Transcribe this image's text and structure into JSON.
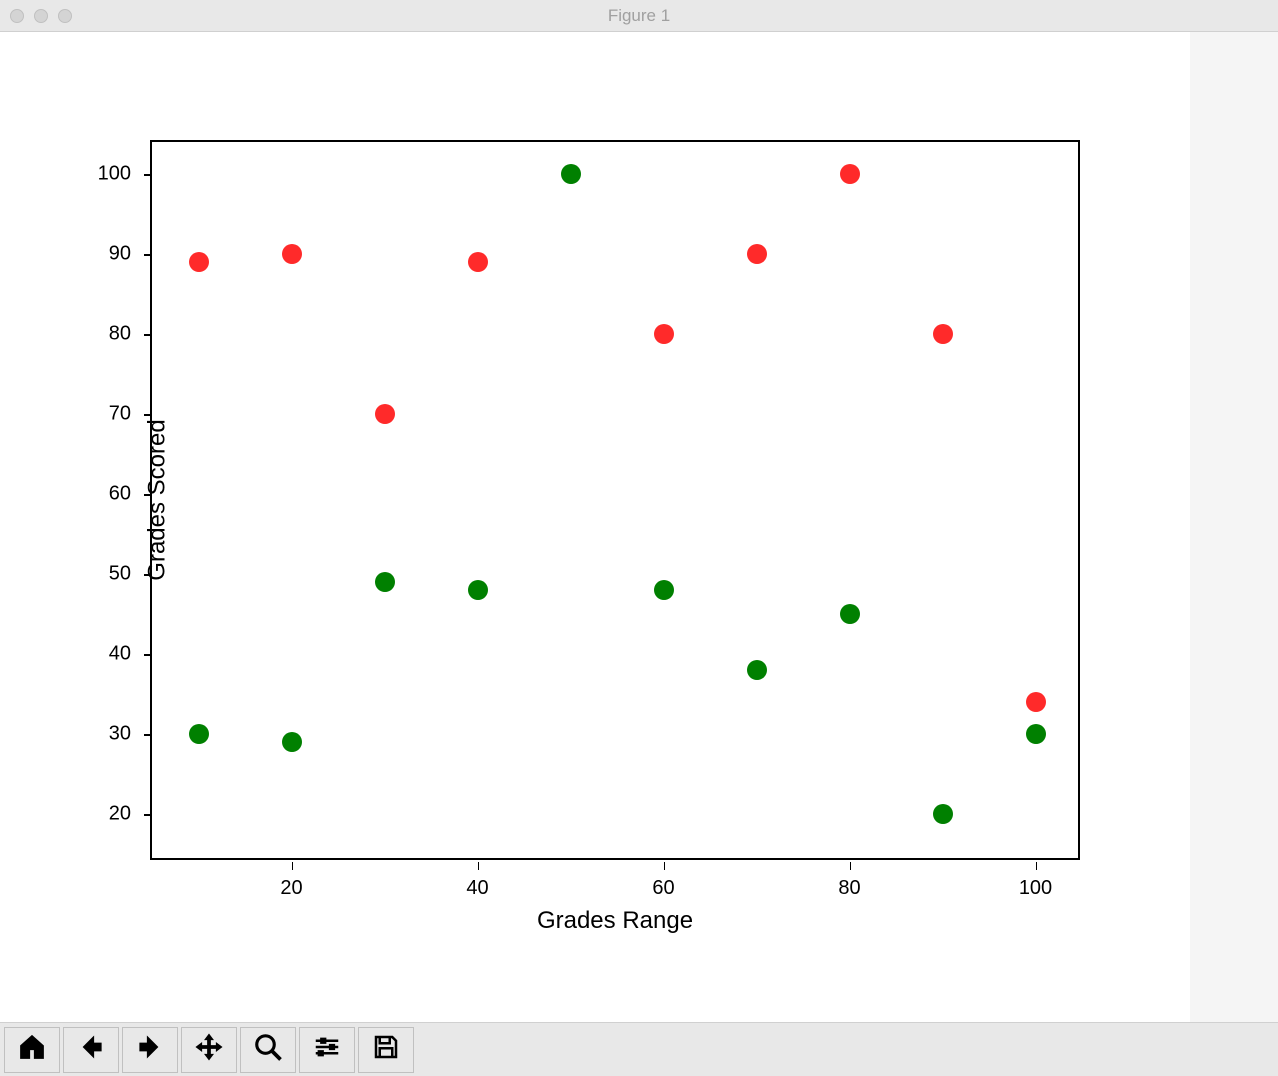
{
  "window": {
    "title": "Figure 1"
  },
  "toolbar": {
    "home": "Home",
    "back": "Back",
    "forward": "Forward",
    "pan": "Pan",
    "zoom": "Zoom",
    "configure": "Configure subplots",
    "save": "Save"
  },
  "chart_data": {
    "type": "scatter",
    "xlabel": "Grades Range",
    "ylabel": "Grades Scored",
    "xlim": [
      5,
      105
    ],
    "ylim": [
      14,
      104
    ],
    "xticks": [
      20,
      40,
      60,
      80,
      100
    ],
    "yticks": [
      20,
      30,
      40,
      50,
      60,
      70,
      80,
      90,
      100
    ],
    "series": [
      {
        "name": "red",
        "color": "#ff2a2a",
        "points": [
          {
            "x": 10,
            "y": 89
          },
          {
            "x": 20,
            "y": 90
          },
          {
            "x": 30,
            "y": 70
          },
          {
            "x": 40,
            "y": 89
          },
          {
            "x": 60,
            "y": 80
          },
          {
            "x": 70,
            "y": 90
          },
          {
            "x": 80,
            "y": 100
          },
          {
            "x": 90,
            "y": 80
          },
          {
            "x": 100,
            "y": 34
          }
        ]
      },
      {
        "name": "green",
        "color": "#008000",
        "points": [
          {
            "x": 10,
            "y": 30
          },
          {
            "x": 20,
            "y": 29
          },
          {
            "x": 30,
            "y": 49
          },
          {
            "x": 40,
            "y": 48
          },
          {
            "x": 50,
            "y": 100
          },
          {
            "x": 60,
            "y": 48
          },
          {
            "x": 70,
            "y": 38
          },
          {
            "x": 80,
            "y": 45
          },
          {
            "x": 90,
            "y": 20
          },
          {
            "x": 100,
            "y": 30
          }
        ]
      }
    ]
  }
}
